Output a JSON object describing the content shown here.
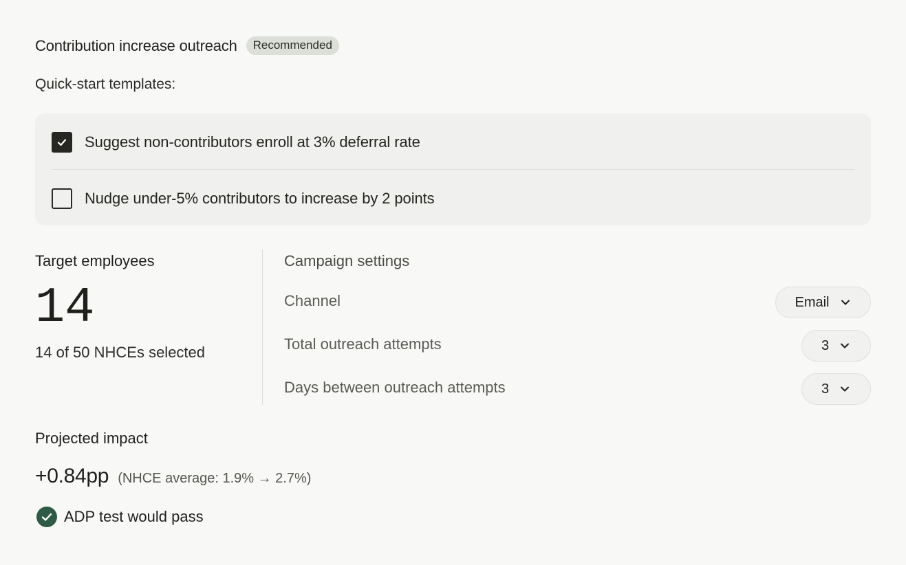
{
  "header": {
    "title": "Contribution increase outreach",
    "badge": "Recommended"
  },
  "templates": {
    "label": "Quick-start templates:",
    "items": [
      {
        "label": "Suggest non-contributors enroll at 3% deferral rate",
        "checked": true
      },
      {
        "label": "Nudge under-5% contributors to increase by 2 points",
        "checked": false
      }
    ]
  },
  "target": {
    "label": "Target employees",
    "count": "14",
    "subtitle": "14 of 50 NHCEs selected"
  },
  "campaign": {
    "label": "Campaign settings",
    "settings": [
      {
        "label": "Channel",
        "value": "Email"
      },
      {
        "label": "Total outreach attempts",
        "value": "3"
      },
      {
        "label": "Days between outreach attempts",
        "value": "3"
      }
    ]
  },
  "impact": {
    "label": "Projected impact",
    "value": "+0.84pp",
    "detail": "(NHCE average: 1.9% → 2.7%)",
    "status": "ADP test would pass",
    "status_color": "#2f5a45"
  }
}
